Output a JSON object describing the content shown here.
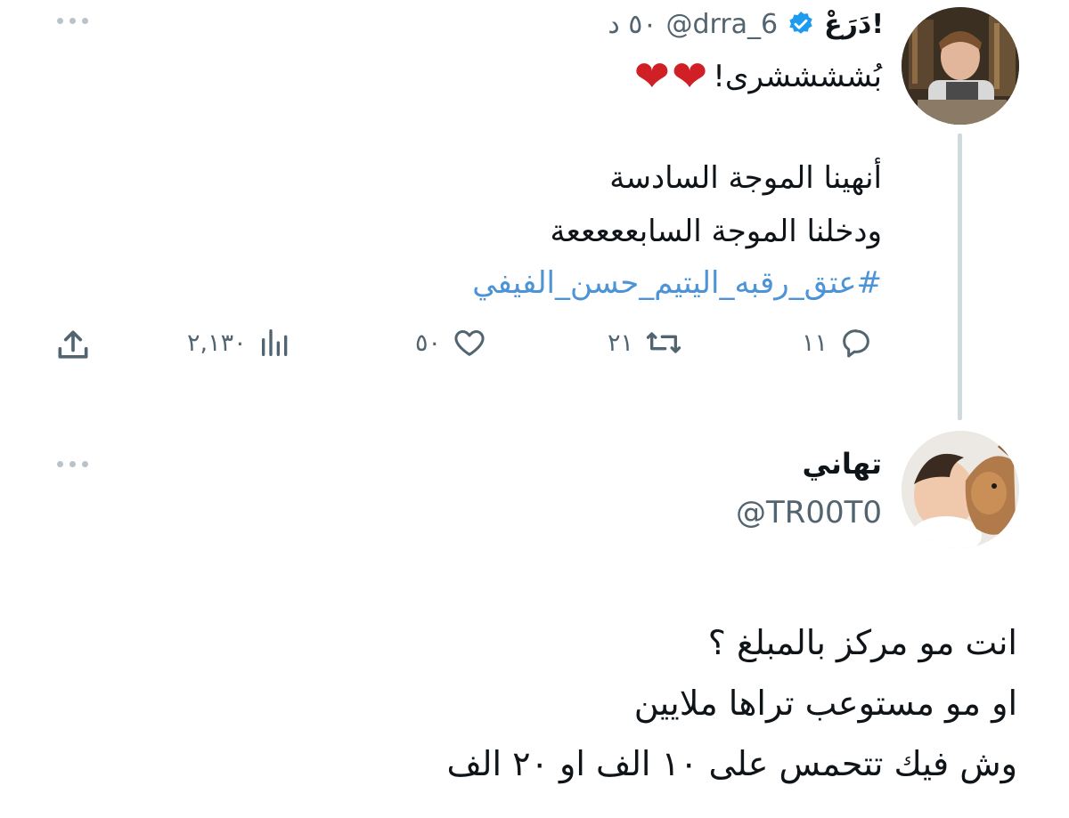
{
  "tweet1": {
    "display_name": "دَرَعْ!",
    "handle": "@drra_6",
    "time": "٥٠ د",
    "header_text": "بُششششرى!",
    "hearts": "❤❤",
    "body_line1": "أنهينا الموجة السادسة",
    "body_line2": "ودخلنا الموجة السابعععععة",
    "hashtag": "#عتق_رقبه_اليتيم_حسن_الفيفي",
    "replies": "١١",
    "retweets": "٢١",
    "likes": "٥٠",
    "views": "٢,١٣٠"
  },
  "tweet2": {
    "display_name": "تهاني",
    "handle": "@TR00T0",
    "line1": "انت مو مركز بالمبلغ ؟",
    "line2": "او مو مستوعب تراها ملايين",
    "line3": "وش فيك تتحمس على ١٠ الف او ٢٠ الف"
  },
  "colors": {
    "verified": "#1d9bf0",
    "hashtag": "#4c94d6",
    "secondary_text": "#536471",
    "thread_line": "#cfd9de"
  }
}
